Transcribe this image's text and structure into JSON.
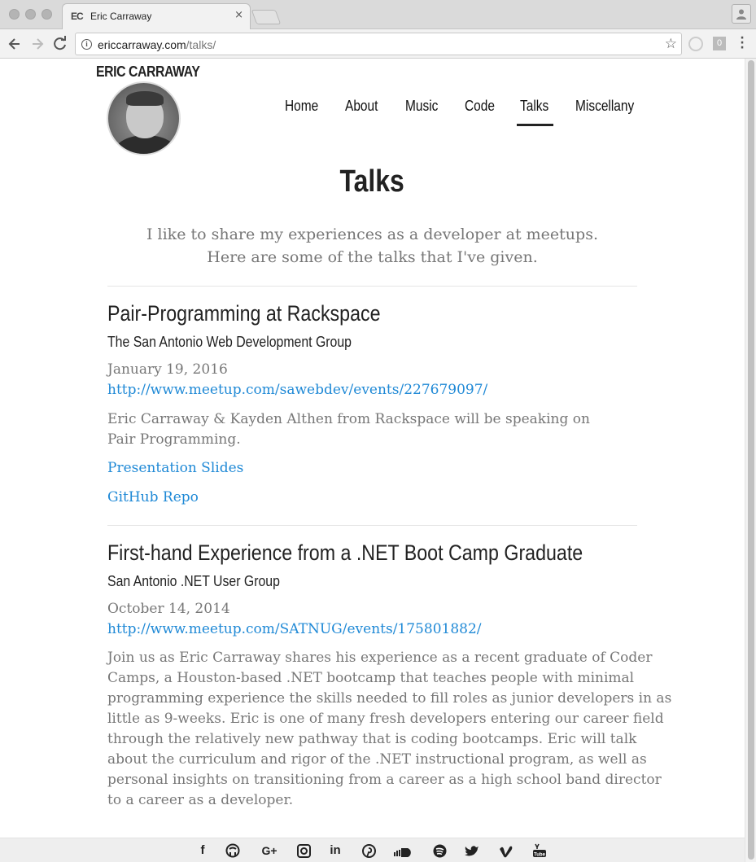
{
  "browser": {
    "tab_favicon": "EC",
    "tab_title": "Eric Carraway",
    "tab_close": "×",
    "url_domain": "ericcarraway.com",
    "url_path": "/talks/",
    "ext_badge": "0"
  },
  "site": {
    "name": "ERIC CARRAWAY",
    "nav": [
      "Home",
      "About",
      "Music",
      "Code",
      "Talks",
      "Miscellany"
    ],
    "active_nav": "Talks"
  },
  "page": {
    "title": "Talks",
    "intro_line1": "I like to share my experiences as a developer at meetups.",
    "intro_line2": "Here are some of the talks that I've given."
  },
  "talks": [
    {
      "title": "Pair-Programming at Rackspace",
      "group": "The San Antonio Web Development Group",
      "date": "January 19, 2016",
      "url": "http://www.meetup.com/sawebdev/events/227679097/",
      "desc_line1": "Eric Carraway & Kayden Althen from Rackspace will be speaking on",
      "desc_line2": "Pair Programming.",
      "link1": "Presentation Slides",
      "link2": "GitHub Repo"
    },
    {
      "title": "First-hand Experience from a .NET Boot Camp Graduate",
      "group": "San Antonio .NET User Group",
      "date": "October 14, 2014",
      "url": "http://www.meetup.com/SATNUG/events/175801882/",
      "desc_lines": [
        "Join us as Eric Carraway shares his experience as a recent graduate of Coder",
        "Camps, a Houston-based .NET bootcamp that teaches people with minimal",
        "programming experience the skills needed to fill roles as junior developers in as",
        "little as 9-weeks. Eric is one of many fresh developers entering our career field",
        "through the relatively new pathway that is coding bootcamps. Eric will talk",
        "about the curriculum and rigor of the .NET instructional program, as well as",
        "personal insights on transitioning from a career as a high school band director",
        "to a career as a developer."
      ]
    }
  ],
  "footer": {
    "social": [
      "facebook-icon",
      "github-icon",
      "google-plus-icon",
      "instagram-icon",
      "linkedin-icon",
      "pinterest-icon",
      "soundcloud-icon",
      "spotify-icon",
      "twitter-icon",
      "vimeo-icon",
      "youtube-icon"
    ]
  },
  "colors": {
    "link": "#1f89d6",
    "muted_text": "#777777",
    "heading": "#222222"
  }
}
